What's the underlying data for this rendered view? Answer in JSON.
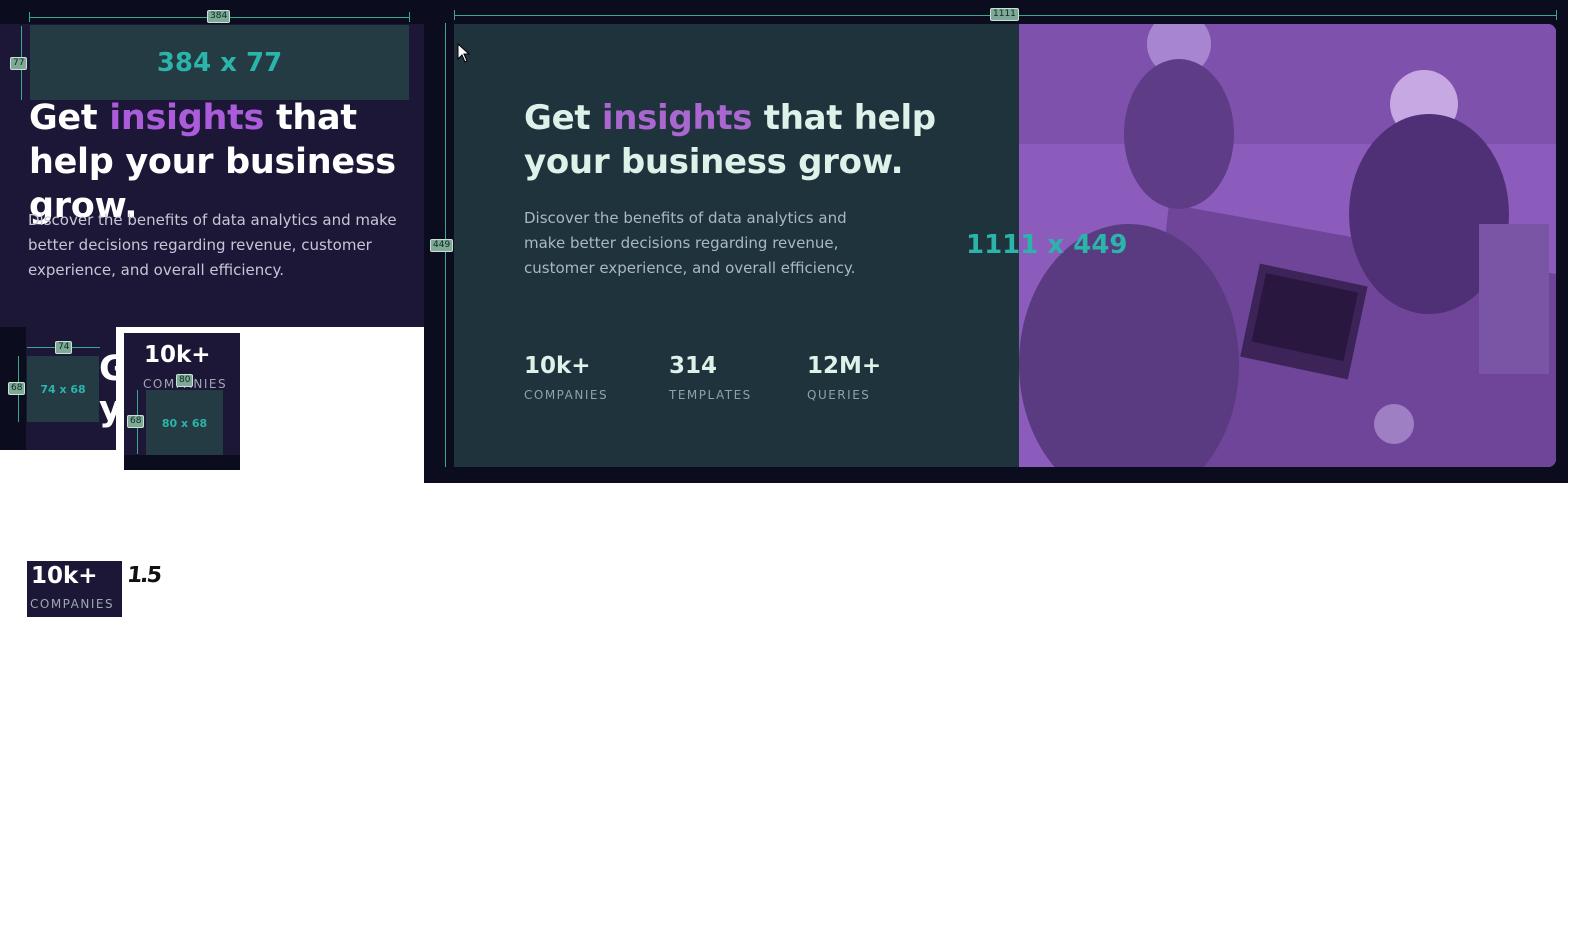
{
  "mobile_preview": {
    "headline": {
      "part1": "Get ",
      "accent": "insights",
      "part2": " that help your business grow."
    },
    "description": "Discover the benefits of data analytics and make better decisions regarding revenue, customer experience, and overall efficiency."
  },
  "desktop_preview": {
    "headline": {
      "part1": "Get ",
      "accent": "insights",
      "part2": " that help your business grow."
    },
    "description": "Discover the benefits of data analytics and make better decisions regarding revenue, customer experience, and overall efficiency.",
    "stats": [
      {
        "value": "10k+",
        "label": "COMPANIES"
      },
      {
        "value": "314",
        "label": "TEMPLATES"
      },
      {
        "value": "12M+",
        "label": "QUERIES"
      }
    ],
    "image_alt": "team working around a table with laptops"
  },
  "measurements": {
    "mobile_width": "384",
    "mobile_height": "77",
    "mobile_overlay": "384 x 77",
    "desktop_width": "1111",
    "desktop_height": "449",
    "desktop_overlay": "1111 x 449",
    "stat_box_width": "74",
    "stat_box_height": "68",
    "stat_box_overlay": "74 x 68",
    "stat_box2_width": "80",
    "stat_box2_height": "68",
    "stat_box2_overlay": "80 x 68"
  },
  "stat_sample_1": {
    "value": "10k+",
    "label": "COMPANIES"
  },
  "stat_sample_2": {
    "value": "10k+",
    "label": "COMPANIES"
  },
  "partial_headline": {
    "line1": "G",
    "line2": "y"
  },
  "scribble": "1.5",
  "colors": {
    "mobile_bg": "#1c1736",
    "desktop_bg": "#1f333c",
    "accent": "#ab5cdb",
    "image_tint": "#8b5cba",
    "measure": "#2bb4a9"
  }
}
